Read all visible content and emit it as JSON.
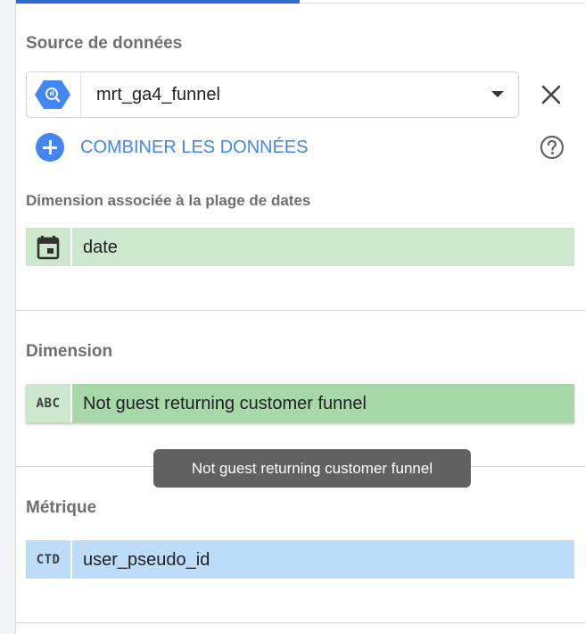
{
  "data_source": {
    "section_title": "Source de données",
    "name": "mrt_ga4_funnel",
    "icon": "bigquery-icon",
    "blend_label": "COMBINER LES DONNÉES"
  },
  "date_range": {
    "title": "Dimension associée à la plage de dates",
    "field": "date",
    "icon": "calendar-icon"
  },
  "dimension": {
    "title": "Dimension",
    "type_label": "ABC",
    "field": "Not guest returning customer funnel"
  },
  "tooltip": {
    "text": "Not guest returning customer funnel"
  },
  "metric": {
    "title": "Métrique",
    "type_label": "CTD",
    "field": "user_pseudo_id"
  },
  "colors": {
    "accent": "#4285f4",
    "tab_indicator": "#3367d6",
    "dimension_chip": "#a8d8a8",
    "date_chip": "#cbe8cc",
    "metric_chip": "#bddcf7",
    "tooltip_bg": "#616161"
  }
}
